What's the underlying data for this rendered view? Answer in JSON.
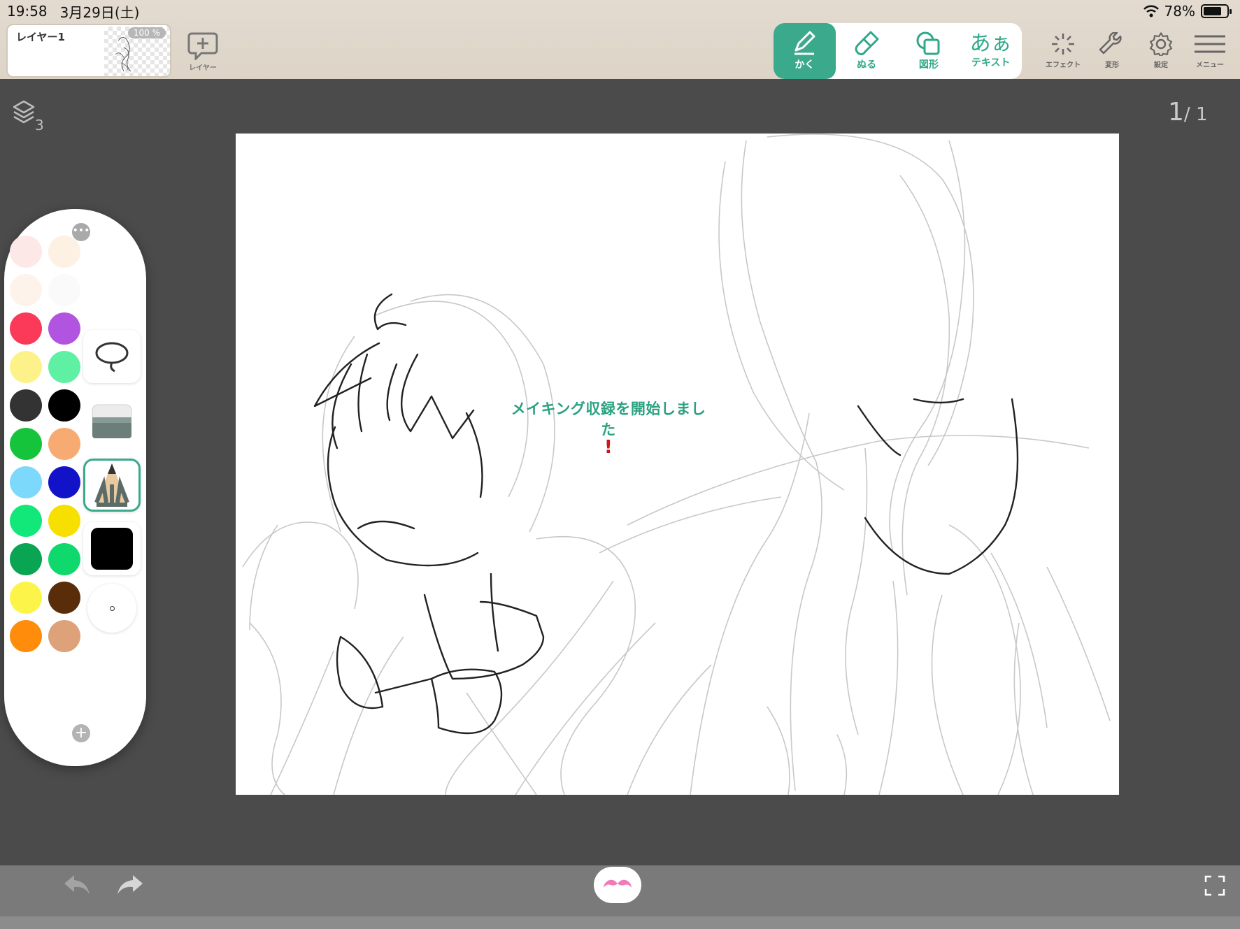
{
  "status_bar": {
    "time": "19:58",
    "date": "3月29日(土)",
    "battery": "78%",
    "battery_level": 0.78
  },
  "layer_thumb": {
    "name": "レイヤー1",
    "opacity": "100 %"
  },
  "add_layer": {
    "label": "レイヤー"
  },
  "tools": [
    {
      "id": "draw",
      "label": "かく",
      "icon": "pen-icon",
      "active": true
    },
    {
      "id": "fill",
      "label": "ぬる",
      "icon": "brush-icon",
      "active": false
    },
    {
      "id": "shape",
      "label": "図形",
      "icon": "shape-icon",
      "active": false
    },
    {
      "id": "text",
      "label": "テキスト",
      "glyph": "あぁ",
      "icon": "text-icon",
      "active": false
    }
  ],
  "right_tools": [
    {
      "label": "エフェクト",
      "icon": "sparkle-icon"
    },
    {
      "label": "変形",
      "icon": "wrench-icon"
    },
    {
      "label": "設定",
      "icon": "gear-icon"
    },
    {
      "label": "メニュー",
      "icon": "hamburger-icon"
    }
  ],
  "layers_indicator": {
    "count": "3"
  },
  "page_indicator": {
    "current": "1",
    "total": "1"
  },
  "toast": {
    "message": "メイキング収録を開始しました",
    "mark": "!"
  },
  "palette": {
    "colors": [
      "#fde8e8",
      "#fdf1e3",
      "#fdf3ea",
      "#fafafa",
      "#fb3a5a",
      "#b155e0",
      "#fdf28a",
      "#5ff0a4",
      "#333333",
      "#000000",
      "#16c43c",
      "#f7ab72",
      "#7dd9fc",
      "#1212c8",
      "#12e87a",
      "#f7e000",
      "#0aa552",
      "#0fd96c",
      "#fdf44a",
      "#5a2d0a",
      "#ff8c0a",
      "#dda27a"
    ],
    "current_color": "#000000",
    "tools": [
      "lasso-icon",
      "eraser-icon",
      "pencil-icon",
      "color-swatch",
      "brush-size"
    ]
  }
}
